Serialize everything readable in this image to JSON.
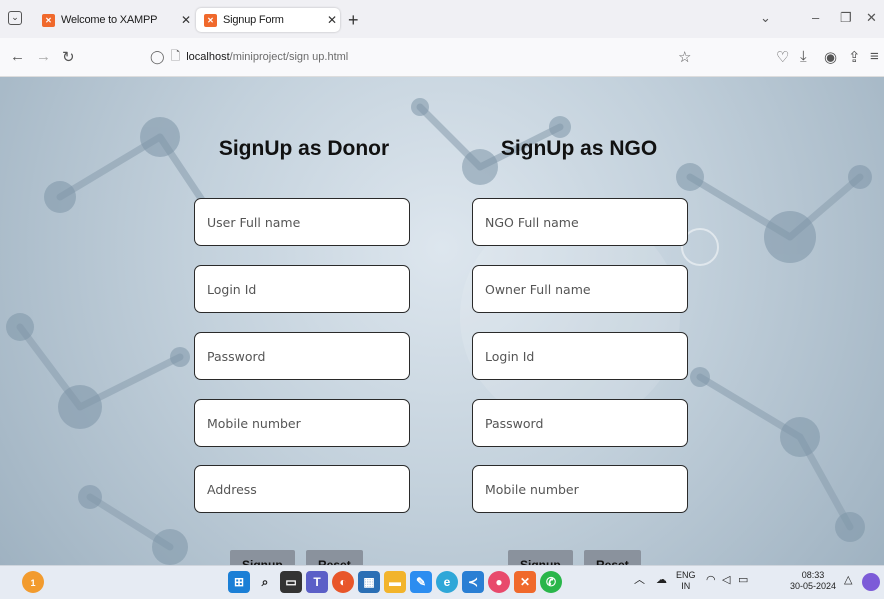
{
  "browser": {
    "tabs": [
      {
        "title": "Welcome to XAMPP",
        "active": false
      },
      {
        "title": "Signup Form",
        "active": true
      }
    ],
    "url_host": "localhost",
    "url_path": "/miniproject/sign up.html"
  },
  "donor": {
    "title": "SignUp as Donor",
    "fields": [
      {
        "placeholder": "User Full name"
      },
      {
        "placeholder": "Login Id"
      },
      {
        "placeholder": "Password"
      },
      {
        "placeholder": "Mobile number"
      },
      {
        "placeholder": "Address"
      }
    ],
    "signup_label": "Signup",
    "reset_label": "Reset"
  },
  "ngo": {
    "title": "SignUp as NGO",
    "fields": [
      {
        "placeholder": "NGO Full name"
      },
      {
        "placeholder": "Owner Full name"
      },
      {
        "placeholder": "Login Id"
      },
      {
        "placeholder": "Password"
      },
      {
        "placeholder": "Mobile number"
      }
    ],
    "signup_label": "Signup",
    "reset_label": "Reset"
  },
  "taskbar": {
    "notification_count": "1",
    "lang_line1": "ENG",
    "lang_line2": "IN",
    "time": "08:33",
    "date": "30-05-2024"
  },
  "colors": {
    "xampp_orange": "#f0692c",
    "button_gray": "#8a929d"
  }
}
